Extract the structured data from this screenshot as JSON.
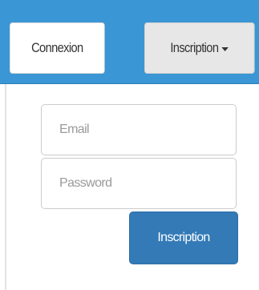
{
  "tabs": {
    "login_label": "Connexion",
    "signup_label": "Inscription"
  },
  "form": {
    "email_placeholder": "Email",
    "email_value": "",
    "password_placeholder": "Password",
    "password_value": "",
    "submit_label": "Inscription"
  },
  "colors": {
    "header": "#3a96d5",
    "primary_button": "#337ab7",
    "inactive_tab": "#e7e7e7"
  }
}
